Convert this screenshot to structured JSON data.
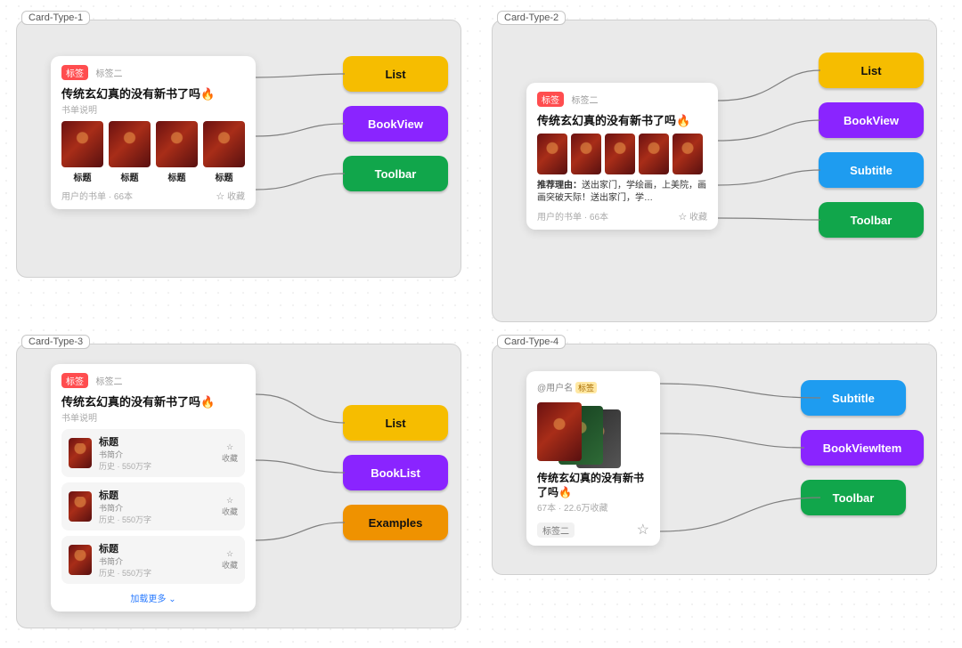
{
  "sections": {
    "type1": {
      "label": "Card-Type-1",
      "chips": [
        "List",
        "BookView",
        "Toolbar"
      ],
      "chip_colors": [
        "yellow",
        "purple",
        "green"
      ]
    },
    "type2": {
      "label": "Card-Type-2",
      "chips": [
        "List",
        "BookView",
        "Subtitle",
        "Toolbar"
      ],
      "chip_colors": [
        "yellow",
        "purple",
        "blue",
        "green"
      ]
    },
    "type3": {
      "label": "Card-Type-3",
      "chips": [
        "List",
        "BookList",
        "Examples"
      ],
      "chip_colors": [
        "yellow",
        "purple",
        "orange"
      ]
    },
    "type4": {
      "label": "Card-Type-4",
      "chips": [
        "Subtitle",
        "BookViewItem",
        "Toolbar"
      ],
      "chip_colors": [
        "blue",
        "purple",
        "green"
      ]
    }
  },
  "card1": {
    "tag1": "标签",
    "tag2": "标签二",
    "title": "传统玄幻真的没有新书了吗",
    "subtitle": "书单说明",
    "books": [
      "标题",
      "标题",
      "标题",
      "标题"
    ],
    "footer_left": "用户的书单 · 66本",
    "footer_right": "收藏"
  },
  "card2": {
    "tag1": "标签",
    "tag2": "标签二",
    "title": "传统玄幻真的没有新书了吗",
    "recommend_prefix": "推荐理由：",
    "recommend": "送出家门，学绘画，上美院，画画突破天际！送出家门，学…",
    "footer_left": "用户的书单 · 66本",
    "footer_right": "收藏"
  },
  "card3": {
    "tag1": "标签",
    "tag2": "标签二",
    "title": "传统玄幻真的没有新书了吗",
    "subtitle": "书单说明",
    "rows": [
      {
        "title": "标题",
        "desc": "书简介",
        "stat": "历史 · 550万字",
        "fav": "收藏"
      },
      {
        "title": "标题",
        "desc": "书简介",
        "stat": "历史 · 550万字",
        "fav": "收藏"
      },
      {
        "title": "标题",
        "desc": "书简介",
        "stat": "历史 · 550万字",
        "fav": "收藏"
      }
    ],
    "load_more": "加载更多"
  },
  "card4": {
    "user": "@用户名",
    "user_tag": "标签",
    "title": "传统玄幻真的没有新书了吗",
    "stat": "67本  ·  22.6万收藏",
    "tag2": "标签二"
  }
}
